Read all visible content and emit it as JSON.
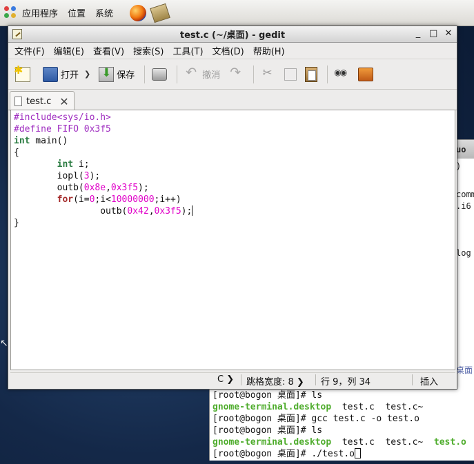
{
  "panel": {
    "menus": [
      "应用程序",
      "位置",
      "系统"
    ]
  },
  "terminal": {
    "side_fragments": [
      "uo",
      ")",
      "comm",
      ".i6",
      "log",
      "桌面"
    ],
    "lines": [
      {
        "parts": [
          {
            "text": "[root@bogon 桌面]# ls",
            "cls": ""
          }
        ]
      },
      {
        "parts": [
          {
            "text": "gnome-terminal.desktop",
            "cls": "green"
          },
          {
            "text": "  test.c  test.c~",
            "cls": ""
          }
        ]
      },
      {
        "parts": [
          {
            "text": "[root@bogon 桌面]# gcc test.c -o test.o",
            "cls": ""
          }
        ]
      },
      {
        "parts": [
          {
            "text": "[root@bogon 桌面]# ls",
            "cls": ""
          }
        ]
      },
      {
        "parts": [
          {
            "text": "gnome-terminal.desktop",
            "cls": "green"
          },
          {
            "text": "  test.c  test.c~  ",
            "cls": ""
          },
          {
            "text": "test.o",
            "cls": "green"
          }
        ]
      },
      {
        "parts": [
          {
            "text": "[root@bogon 桌面]# ./test.o",
            "cls": ""
          }
        ],
        "cursor": true
      }
    ]
  },
  "gedit": {
    "title": "test.c (~/桌面) - gedit",
    "window_buttons": [
      "_",
      "□",
      "✕"
    ],
    "menu": [
      "文件(F)",
      "编辑(E)",
      "查看(V)",
      "搜索(S)",
      "工具(T)",
      "文档(D)",
      "帮助(H)"
    ],
    "toolbar": {
      "open_label": "打开",
      "save_label": "保存",
      "undo_label": "撤消"
    },
    "tab_label": "test.c",
    "code_lines": [
      [
        {
          "t": "#include<sys/io.h>",
          "c": "pp"
        }
      ],
      [
        {
          "t": "#define FIFO 0x3f5",
          "c": "pp"
        }
      ],
      [
        {
          "t": "int",
          "c": "kw"
        },
        {
          "t": " main()",
          "c": ""
        }
      ],
      [
        {
          "t": "{",
          "c": ""
        }
      ],
      [
        {
          "t": "        ",
          "c": ""
        },
        {
          "t": "int",
          "c": "kw"
        },
        {
          "t": " i;",
          "c": ""
        }
      ],
      [
        {
          "t": "        iopl(",
          "c": ""
        },
        {
          "t": "3",
          "c": "num"
        },
        {
          "t": ");",
          "c": ""
        }
      ],
      [
        {
          "t": "        outb(",
          "c": ""
        },
        {
          "t": "0x8e",
          "c": "num"
        },
        {
          "t": ",",
          "c": ""
        },
        {
          "t": "0x3f5",
          "c": "num"
        },
        {
          "t": ");",
          "c": ""
        }
      ],
      [
        {
          "t": "        ",
          "c": ""
        },
        {
          "t": "for",
          "c": "kw2"
        },
        {
          "t": "(i=",
          "c": ""
        },
        {
          "t": "0",
          "c": "num"
        },
        {
          "t": ";i<",
          "c": ""
        },
        {
          "t": "10000000",
          "c": "num"
        },
        {
          "t": ";i++)",
          "c": ""
        }
      ],
      [
        {
          "t": "                outb(",
          "c": ""
        },
        {
          "t": "0x42",
          "c": "num"
        },
        {
          "t": ",",
          "c": ""
        },
        {
          "t": "0x3f5",
          "c": "num"
        },
        {
          "t": ");",
          "c": ""
        },
        {
          "cursor": true
        }
      ],
      [
        {
          "t": "}",
          "c": ""
        }
      ]
    ],
    "status": {
      "language": "C",
      "tab_width": "跳格宽度: 8",
      "position": "行 9，列 34",
      "mode": "插入"
    }
  }
}
